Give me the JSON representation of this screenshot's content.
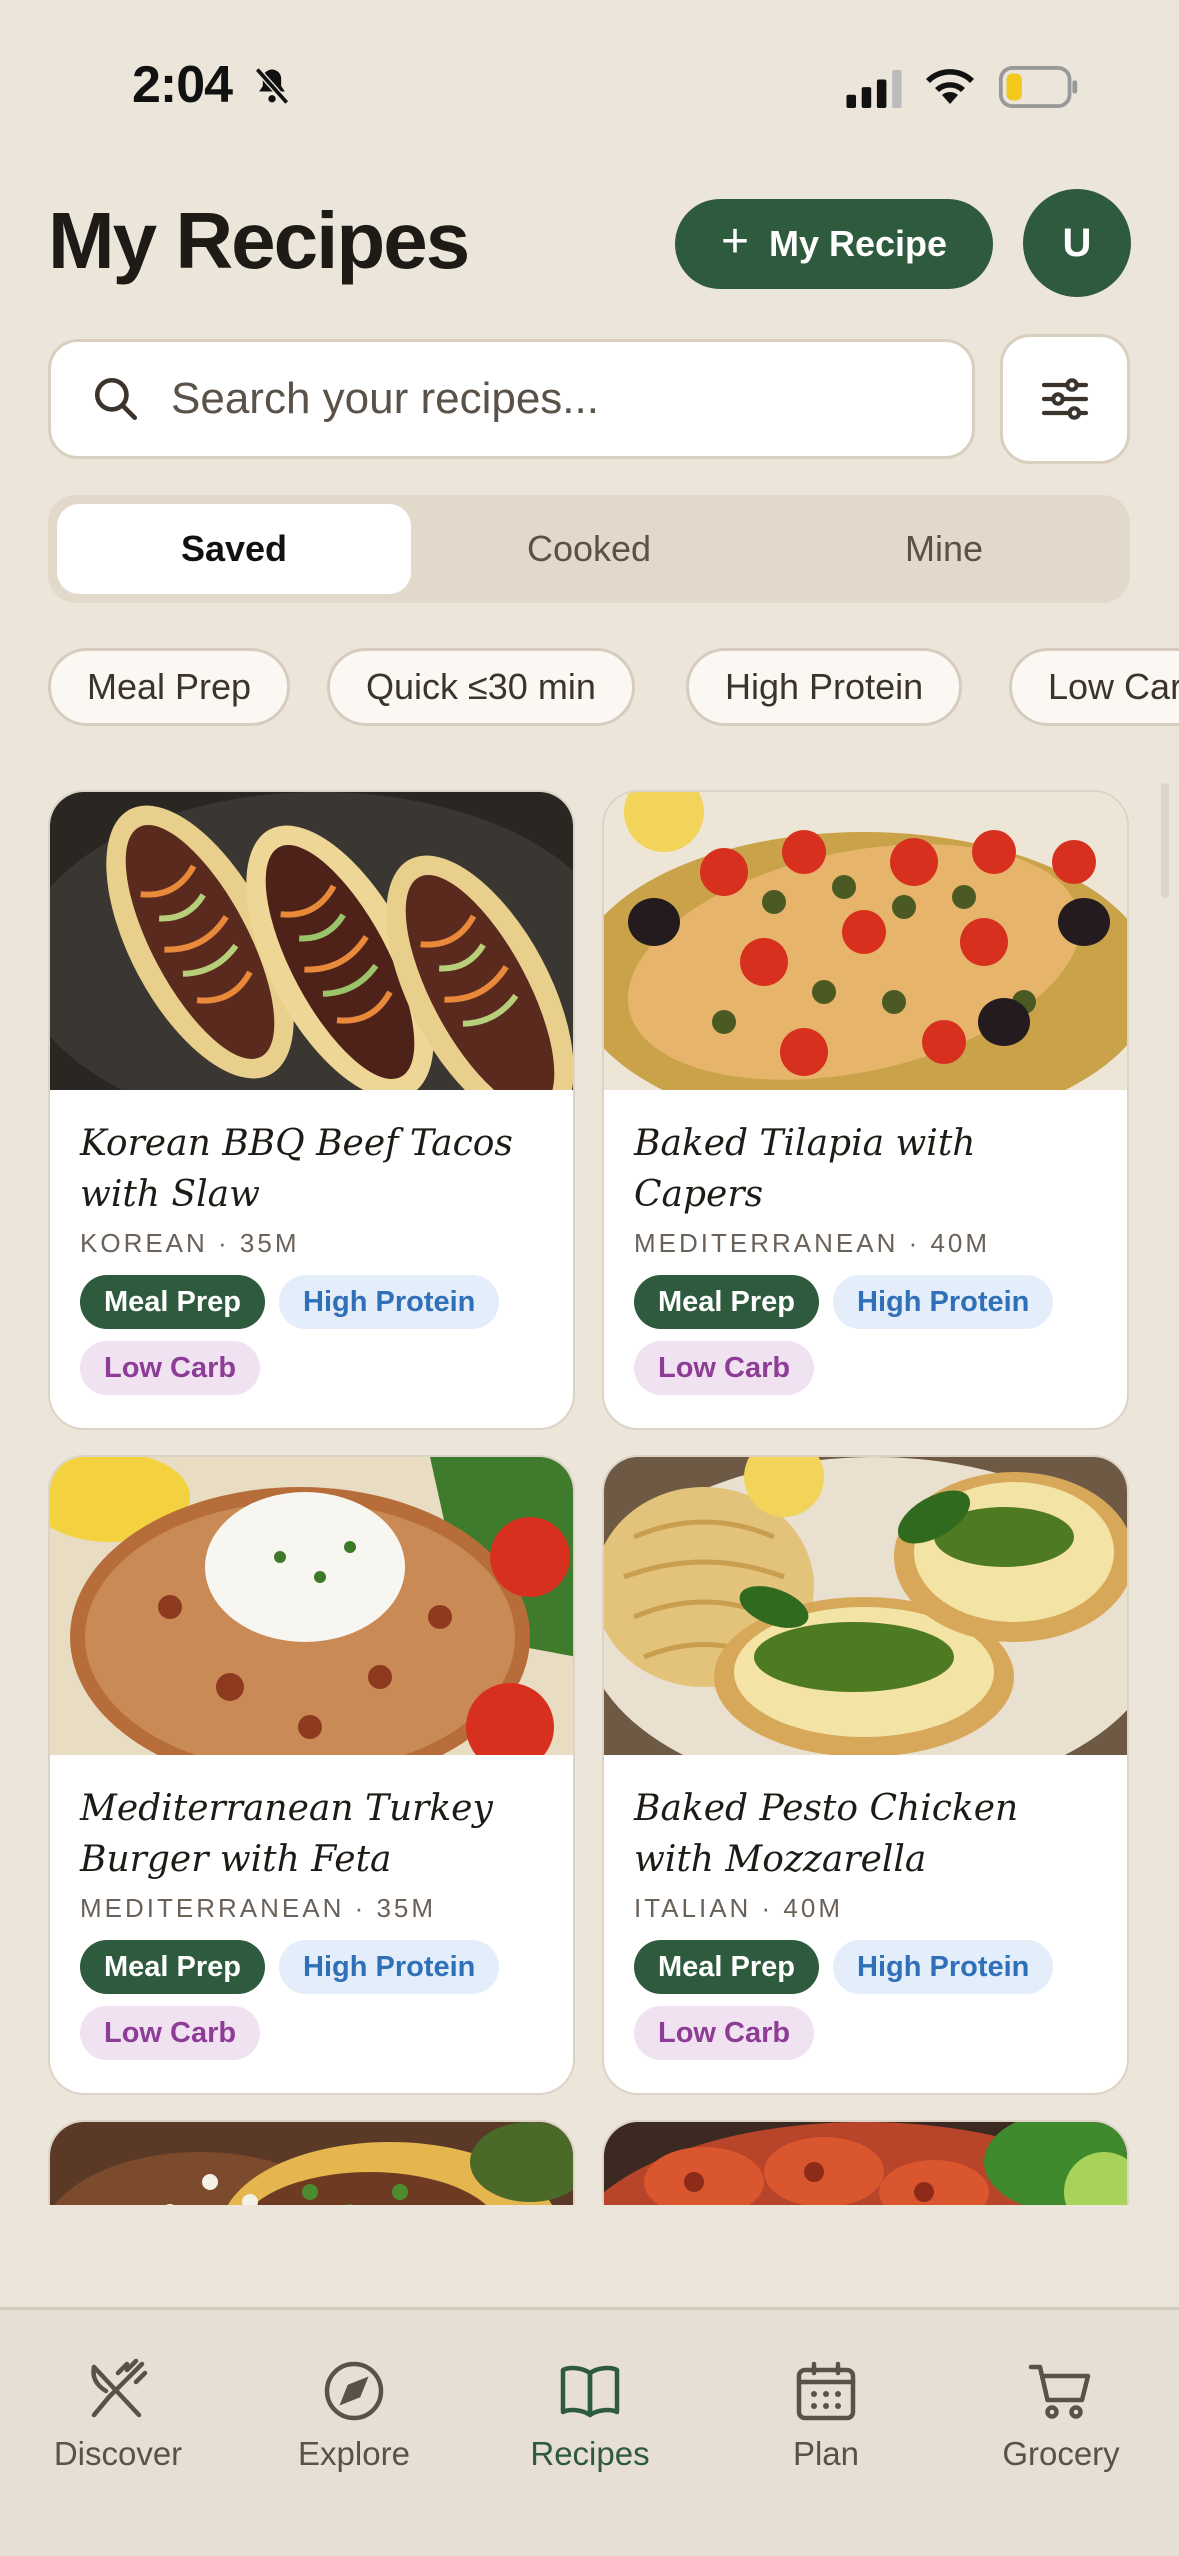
{
  "status_bar": {
    "time": "2:04"
  },
  "header": {
    "title": "My Recipes",
    "add_button_label": "My Recipe",
    "avatar_initial": "U"
  },
  "search": {
    "placeholder": "Search your recipes..."
  },
  "tabs": [
    {
      "label": "Saved",
      "active": true
    },
    {
      "label": "Cooked",
      "active": false
    },
    {
      "label": "Mine",
      "active": false
    }
  ],
  "chips": [
    {
      "label": "Meal Prep"
    },
    {
      "label": "Quick ≤30 min"
    },
    {
      "label": "High Protein"
    },
    {
      "label": "Low Carb"
    }
  ],
  "recipes": [
    {
      "title": "Korean BBQ Beef Tacos with Slaw",
      "meta": "KOREAN · 35M",
      "tags": [
        "Meal Prep",
        "High Protein",
        "Low Carb"
      ]
    },
    {
      "title": "Baked Tilapia with Capers",
      "meta": "MEDITERRANEAN · 40M",
      "tags": [
        "Meal Prep",
        "High Protein",
        "Low Carb"
      ]
    },
    {
      "title": "Mediterranean Turkey Burger with Feta",
      "meta": "MEDITERRANEAN · 35M",
      "tags": [
        "Meal Prep",
        "High Protein",
        "Low Carb"
      ]
    },
    {
      "title": "Baked Pesto Chicken with Mozzarella",
      "meta": "ITALIAN · 40M",
      "tags": [
        "Meal Prep",
        "High Protein",
        "Low Carb"
      ]
    }
  ],
  "nav": [
    {
      "label": "Discover",
      "icon": "utensils-icon",
      "active": false
    },
    {
      "label": "Explore",
      "icon": "compass-icon",
      "active": false
    },
    {
      "label": "Recipes",
      "icon": "book-icon",
      "active": true
    },
    {
      "label": "Plan",
      "icon": "calendar-icon",
      "active": false
    },
    {
      "label": "Grocery",
      "icon": "cart-icon",
      "active": false
    }
  ],
  "colors": {
    "brand_green": "#2E5A3D",
    "background": "#ECE5DA",
    "protein_blue": "#2F70B8",
    "lowcarb_purple": "#8E3D97"
  }
}
